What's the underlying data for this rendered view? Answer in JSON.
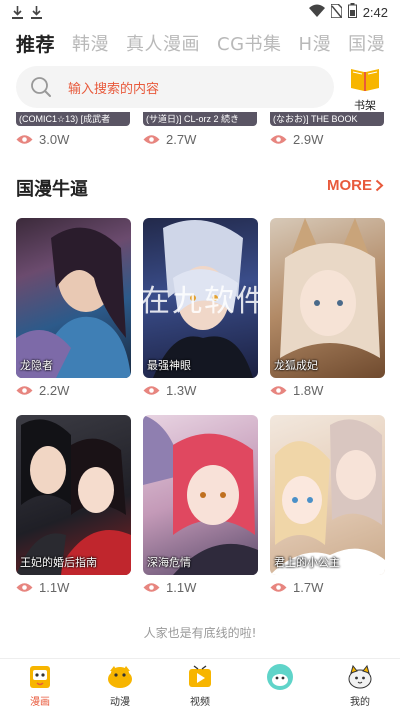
{
  "status_bar": {
    "time": "2:42"
  },
  "tabs": [
    {
      "label": "推荐",
      "active": true
    },
    {
      "label": "韩漫"
    },
    {
      "label": "真人漫画"
    },
    {
      "label": "CG书集"
    },
    {
      "label": "H漫"
    },
    {
      "label": "国漫"
    }
  ],
  "search": {
    "placeholder": "输入搜索的内容"
  },
  "bookshelf": {
    "label": "书架"
  },
  "prev_row": [
    {
      "title": "(COMIC1☆13) [成武者",
      "views": "3.0W"
    },
    {
      "title": "(サ道日)] CL-orz 2 続き",
      "views": "2.7W"
    },
    {
      "title": "(なおお)] THE BOOK",
      "views": "2.9W"
    }
  ],
  "section": {
    "title": "国漫牛逼",
    "more": "MORE"
  },
  "comics": [
    {
      "title": "龙隐者",
      "views": "2.2W"
    },
    {
      "title": "最强神眼",
      "views": "1.3W"
    },
    {
      "title": "龙狐成妃",
      "views": "1.8W"
    },
    {
      "title": "王妃的婚后指南",
      "views": "1.1W"
    },
    {
      "title": "深海危情",
      "views": "1.1W"
    },
    {
      "title": "君上的小公主",
      "views": "1.7W"
    }
  ],
  "watermark": "在九软件",
  "footer_note": "人家也是有底线的啦!",
  "bottom_nav": [
    {
      "label": "漫画",
      "active": true
    },
    {
      "label": "动漫"
    },
    {
      "label": "视频"
    },
    {
      "label": ""
    },
    {
      "label": "我的"
    }
  ],
  "colors": {
    "accent": "#e85a3c",
    "inactive_tab": "#b9b9b9"
  }
}
